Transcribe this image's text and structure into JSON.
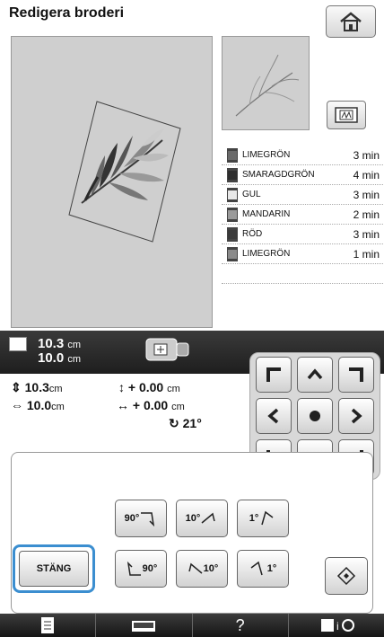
{
  "title": "Redigera broderi",
  "threads": [
    {
      "name": "LIMEGRÖN",
      "time": "3 min",
      "color": "#6a6a6a"
    },
    {
      "name": "SMARAGDGRÖN",
      "time": "4 min",
      "color": "#2e2e2e"
    },
    {
      "name": "GUL",
      "time": "3 min",
      "color": "#e8e8e8"
    },
    {
      "name": "MANDARIN",
      "time": "2 min",
      "color": "#9a9a9a"
    },
    {
      "name": "RÖD",
      "time": "3 min",
      "color": "#3a3a3a"
    },
    {
      "name": "LIMEGRÖN",
      "time": "1 min",
      "color": "#8a8a8a"
    }
  ],
  "size": {
    "height": "10.3",
    "width": "10.0",
    "unit": "cm"
  },
  "params": {
    "height": "10.3",
    "width": "10.0",
    "unit": "cm",
    "v_offset": "+ 0.00",
    "h_offset": "+ 0.00",
    "angle": "21°"
  },
  "rotate_buttons": {
    "r90": "90°",
    "r10": "10°",
    "r1": "1°",
    "l90": "90°",
    "l10": "10°",
    "l1": "1°"
  },
  "close_label": "STÄNG",
  "help_label": "?",
  "icons": [
    "home-icon",
    "sewing-icon",
    "hoop-icon",
    "arrow-up-icon",
    "arrow-down-icon",
    "arrow-left-icon",
    "arrow-right-icon",
    "center-icon",
    "page-icon",
    "machine-icon",
    "settings-icon",
    "reset-icon"
  ]
}
